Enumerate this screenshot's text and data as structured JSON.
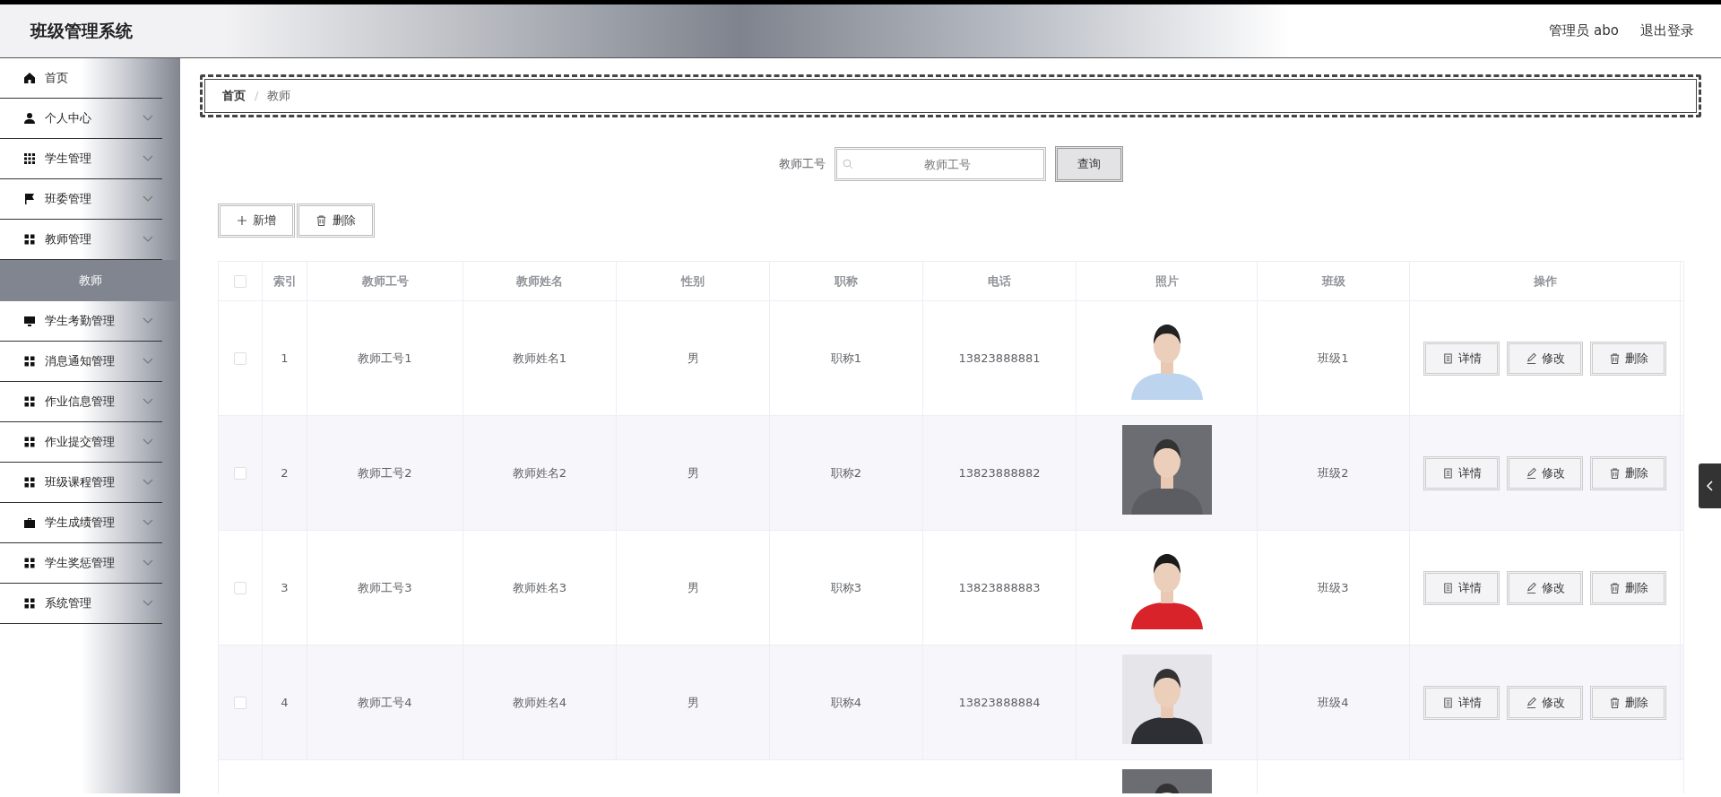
{
  "header": {
    "title": "班级管理系统",
    "user": "管理员 abo",
    "logout": "退出登录"
  },
  "sidebar": {
    "items": [
      {
        "label": "首页",
        "kind": "link"
      },
      {
        "label": "个人中心",
        "kind": "submenu"
      },
      {
        "label": "学生管理",
        "kind": "submenu"
      },
      {
        "label": "班委管理",
        "kind": "submenu"
      },
      {
        "label": "教师管理",
        "kind": "submenu",
        "children": [
          {
            "label": "教师",
            "selected": true
          }
        ]
      },
      {
        "label": "学生考勤管理",
        "kind": "submenu"
      },
      {
        "label": "消息通知管理",
        "kind": "submenu"
      },
      {
        "label": "作业信息管理",
        "kind": "submenu"
      },
      {
        "label": "作业提交管理",
        "kind": "submenu"
      },
      {
        "label": "班级课程管理",
        "kind": "submenu"
      },
      {
        "label": "学生成绩管理",
        "kind": "submenu"
      },
      {
        "label": "学生奖惩管理",
        "kind": "submenu"
      },
      {
        "label": "系统管理",
        "kind": "submenu"
      }
    ]
  },
  "breadcrumb": [
    "首页",
    "教师"
  ],
  "breadcrumb_separator": "/",
  "search": {
    "label": "教师工号",
    "placeholder": "教师工号",
    "button": "查询"
  },
  "toolbar": {
    "add": "新增",
    "delete": "删除"
  },
  "table": {
    "columns": [
      "索引",
      "教师工号",
      "教师姓名",
      "性别",
      "职称",
      "电话",
      "照片",
      "班级",
      "操作"
    ],
    "all_selected": false,
    "rows": [
      {
        "kind": "full",
        "selected": false,
        "cells": [
          "1",
          "教师工号1",
          "教师姓名1",
          "男",
          "职称1",
          "13823888881"
        ],
        "class": "班级1",
        "actions": [
          "详情",
          "修改",
          "删除"
        ]
      },
      {
        "kind": "full",
        "selected": false,
        "cells": [
          "2",
          "教师工号2",
          "教师姓名2",
          "男",
          "职称2",
          "13823888882"
        ],
        "class": "班级2",
        "actions": [
          "详情",
          "修改",
          "删除"
        ]
      },
      {
        "kind": "full",
        "selected": false,
        "cells": [
          "3",
          "教师工号3",
          "教师姓名3",
          "男",
          "职称3",
          "13823888883"
        ],
        "class": "班级3",
        "actions": [
          "详情",
          "修改",
          "删除"
        ]
      },
      {
        "kind": "full",
        "selected": false,
        "cells": [
          "4",
          "教师工号4",
          "教师姓名4",
          "男",
          "职称4",
          "13823888884"
        ],
        "class": "班级4",
        "actions": [
          "详情",
          "修改",
          "删除"
        ]
      },
      {
        "kind": "partial"
      }
    ]
  }
}
